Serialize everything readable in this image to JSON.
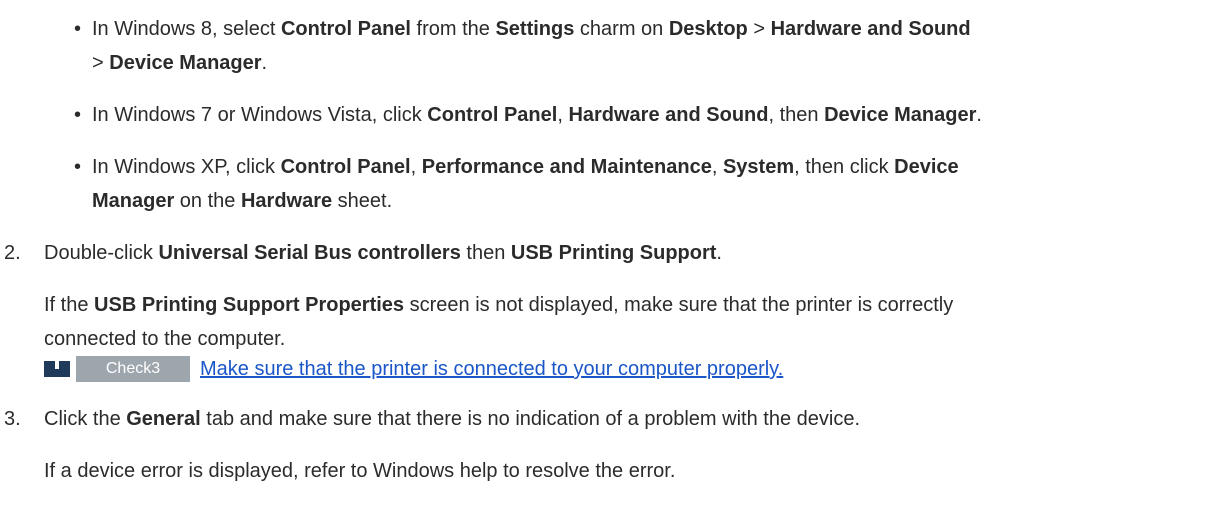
{
  "bullets": {
    "win8": {
      "t1": "In Windows 8, select ",
      "b1": "Control Panel",
      "t2": " from the ",
      "b2": "Settings",
      "t3": " charm on ",
      "b3": "Desktop",
      "t4": " > ",
      "b4": "Hardware and Sound",
      "t5": "> ",
      "b5": "Device Manager",
      "t6": "."
    },
    "win7": {
      "t1": "In Windows 7 or Windows Vista, click ",
      "b1": "Control Panel",
      "t2": ", ",
      "b2": "Hardware and Sound",
      "t3": ", then ",
      "b3": "Device Manager",
      "t4": "."
    },
    "winxp": {
      "t1": "In Windows XP, click ",
      "b1": "Control Panel",
      "t2": ", ",
      "b2": "Performance and Maintenance",
      "t3": ", ",
      "b3": "System",
      "t4": ", then click ",
      "b4": "Device",
      "b5": "Manager",
      "t5": " on the ",
      "b6": "Hardware",
      "t6": " sheet."
    }
  },
  "step2": {
    "num": "2.",
    "t1": "Double-click ",
    "b1": "Universal Serial Bus controllers",
    "t2": " then ",
    "b2": "USB Printing Support",
    "t3": ".",
    "p1": "If the ",
    "pb1": "USB Printing Support Properties",
    "p2": " screen is not displayed, make sure that the printer is correctly",
    "p3": "connected to the computer."
  },
  "check": {
    "label": "Check3",
    "link": "Make sure that the printer is connected to your computer properly."
  },
  "step3": {
    "num": "3.",
    "t1": "Click the ",
    "b1": "General",
    "t2": " tab and make sure that there is no indication of a problem with the device.",
    "p1": "If a device error is displayed, refer to Windows help to resolve the error."
  }
}
